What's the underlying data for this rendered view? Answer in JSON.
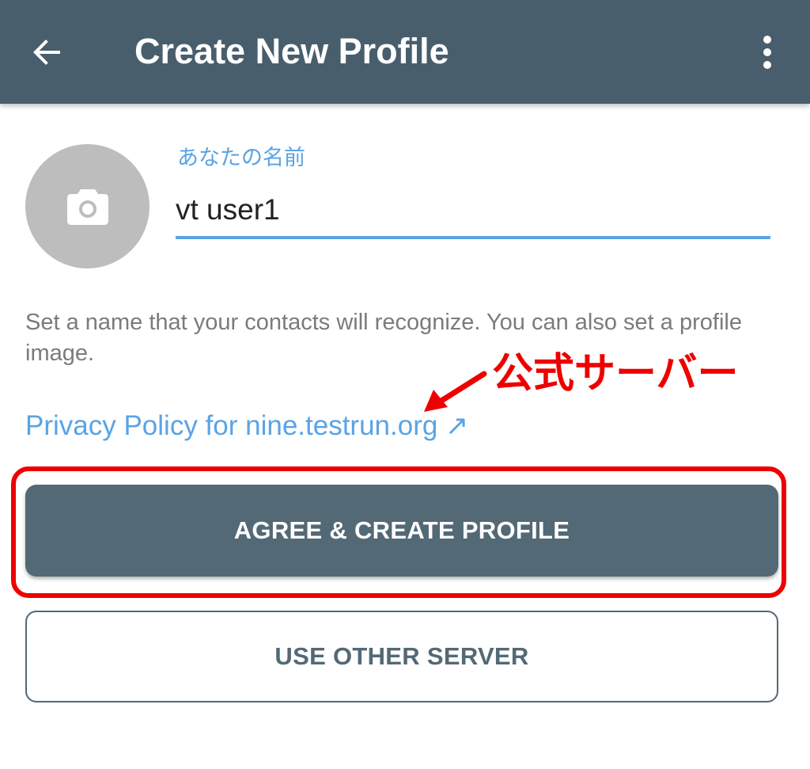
{
  "colors": {
    "app_bar": "#485e6c",
    "accent": "#5aa3e5",
    "primary_button": "#536975",
    "annotation": "#ee0000",
    "avatar_bg": "#bdbdbd"
  },
  "app_bar": {
    "back_icon": "arrow-back-icon",
    "title": "Create New Profile",
    "menu_icon": "more-vert-icon"
  },
  "profile": {
    "avatar_icon": "camera-icon",
    "name_label": "あなたの名前",
    "name_value": "vt user1"
  },
  "helper_text": "Set a name that your contacts will recognize. You can also set a profile image.",
  "privacy_link": "Privacy Policy for nine.testrun.org ↗",
  "annotation": {
    "text": "公式サーバー"
  },
  "buttons": {
    "agree_create": "AGREE & CREATE PROFILE",
    "use_other_server": "USE OTHER SERVER"
  }
}
